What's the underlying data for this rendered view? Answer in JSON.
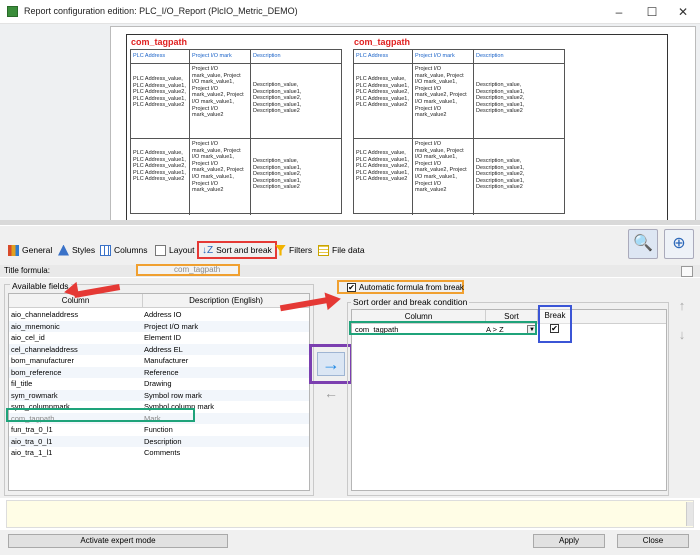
{
  "window": {
    "title": "Report configuration edition: PLC_I/O_Report (PlcIO_Metric_DEMO)",
    "min": "–",
    "max": "☐",
    "close": "✕"
  },
  "preview": {
    "blocks": [
      {
        "title": "com_tagpath",
        "headers": [
          "PLC Address",
          "Project I/O mark",
          "Description"
        ],
        "rows": [
          {
            "c1": "PLC Address_value, PLC Address_value1, PLC Address_value2, PLC Address_value1, PLC Address_value2",
            "c2": "Project I/O mark_value, Project I/O mark_value1, Project I/O mark_value2, Project I/O mark_value1, Project I/O mark_value2",
            "c3": "Description_value, Description_value1, Description_value2, Description_value1, Description_value2"
          },
          {
            "c1": "PLC Address_value, PLC Address_value1, PLC Address_value2, PLC Address_value1, PLC Address_value2",
            "c2": "Project I/O mark_value, Project I/O mark_value1, Project I/O mark_value2, Project I/O mark_value1, Project I/O mark_value2",
            "c3": "Description_value, Description_value1, Description_value2, Description_value1, Description_value2"
          }
        ]
      },
      {
        "title": "com_tagpath",
        "headers": [
          "PLC Address",
          "Project I/O mark",
          "Description"
        ],
        "rows": [
          {
            "c1": "PLC Address_value, PLC Address_value1, PLC Address_value2, PLC Address_value1, PLC Address_value2",
            "c2": "Project I/O mark_value, Project I/O mark_value1, Project I/O mark_value2, Project I/O mark_value1, Project I/O mark_value2",
            "c3": "Description_value, Description_value1, Description_value2, Description_value1, Description_value2"
          },
          {
            "c1": "PLC Address_value, PLC Address_value1, PLC Address_value2, PLC Address_value1, PLC Address_value2",
            "c2": "Project I/O mark_value, Project I/O mark_value1, Project I/O mark_value2, Project I/O mark_value1, Project I/O mark_value2",
            "c3": "Description_value, Description_value1, Description_value2, Description_value1, Description_value2"
          }
        ]
      }
    ]
  },
  "tabs": [
    {
      "label": "General",
      "icon": "general-icon"
    },
    {
      "label": "Styles",
      "icon": "styles-icon"
    },
    {
      "label": "Columns",
      "icon": "columns-icon"
    },
    {
      "label": "Layout",
      "icon": "layout-icon"
    },
    {
      "label": "Sort and break",
      "icon": "sort-icon",
      "active": true
    },
    {
      "label": "Filters",
      "icon": "filter-icon"
    },
    {
      "label": "File data",
      "icon": "file-data-icon"
    }
  ],
  "title_formula": {
    "label": "Title formula:",
    "value": "com_tagpath"
  },
  "available_fields": {
    "label": "Available fields",
    "columns": [
      "Column",
      "Description (English)"
    ],
    "rows": [
      [
        "aio_channeladdress",
        "Address IO"
      ],
      [
        "aio_mnemonic",
        "Project I/O mark"
      ],
      [
        "aio_cel_id",
        "Element ID"
      ],
      [
        "cel_channeladdress",
        "Address EL"
      ],
      [
        "bom_manufacturer",
        "Manufacturer"
      ],
      [
        "bom_reference",
        "Reference"
      ],
      [
        "fil_title",
        "Drawing"
      ],
      [
        "sym_rowmark",
        "Symbol row mark"
      ],
      [
        "sym_columnmark",
        "Symbol column mark"
      ],
      [
        "com_tagpath",
        "Mark"
      ],
      [
        "fun_tra_0_l1",
        "Function"
      ],
      [
        "aio_tra_0_l1",
        "Description"
      ],
      [
        "aio_tra_1_l1",
        "Comments"
      ]
    ]
  },
  "auto_formula": {
    "label": "Automatic formula from break",
    "checked": true
  },
  "sort_order": {
    "label": "Sort order and break condition",
    "columns": [
      "Column",
      "Sort",
      "Break"
    ],
    "rows": [
      {
        "column": "com_tagpath",
        "sort": "A > Z",
        "break": true
      }
    ]
  },
  "buttons": {
    "expert": "Activate expert mode",
    "apply": "Apply",
    "close": "Close"
  },
  "colors": {
    "highlight_red": "#e53935",
    "highlight_orange": "#f0a030",
    "highlight_green": "#1fa37a",
    "highlight_purple": "#7b3fb0",
    "highlight_blue": "#3b55d6",
    "arrow_blue": "#1e88e5"
  }
}
